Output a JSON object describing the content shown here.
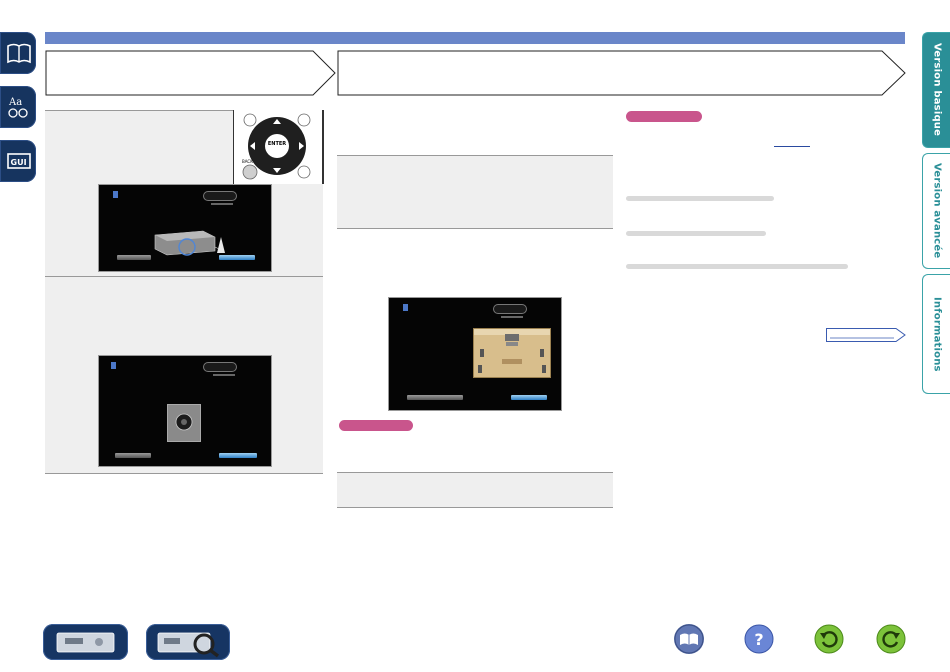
{
  "side_tabs": [
    {
      "label": "Version basique",
      "active": true
    },
    {
      "label": "Version avancée",
      "active": false
    },
    {
      "label": "Informations",
      "active": false
    }
  ],
  "remote": {
    "enter_label": "ENTER",
    "back_label": "BACK"
  },
  "colors": {
    "header_bar": "#6a86c9",
    "active_tab": "#2a8f97",
    "note_pill": "#c9558c",
    "nav_icon_bg": "#16345f"
  },
  "icons": {
    "left_nav": [
      "book-icon",
      "glossary-icon",
      "gui-icon"
    ],
    "bottom_devices": [
      "receiver-front-icon",
      "receiver-search-icon"
    ],
    "bottom_nav": [
      "book-icon",
      "help-icon",
      "back-icon",
      "forward-icon"
    ]
  }
}
